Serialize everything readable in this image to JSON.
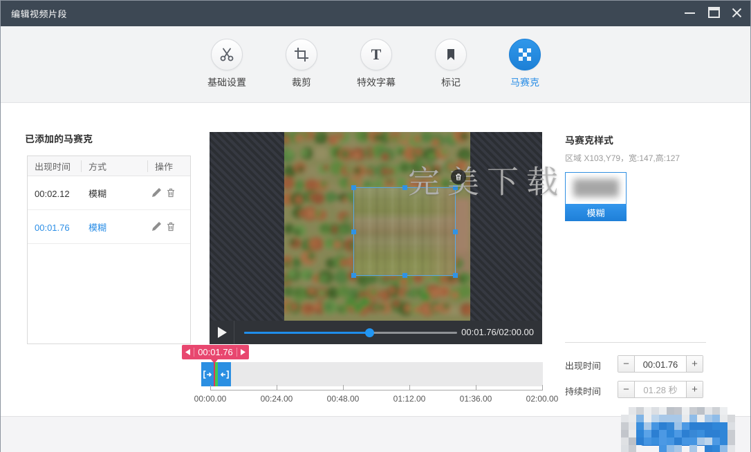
{
  "window": {
    "title": "编辑视频片段"
  },
  "toolbar": {
    "items": [
      {
        "label": "基础设置",
        "icon": "scissors"
      },
      {
        "label": "裁剪",
        "icon": "crop"
      },
      {
        "label": "特效字幕",
        "icon": "text"
      },
      {
        "label": "标记",
        "icon": "bookmark"
      },
      {
        "label": "马赛克",
        "icon": "mosaic",
        "active": true
      }
    ]
  },
  "mosaic_list": {
    "title": "已添加的马赛克",
    "columns": [
      "出现时间",
      "方式",
      "操作"
    ],
    "rows": [
      {
        "time": "00:02.12",
        "mode": "模糊",
        "selected": false
      },
      {
        "time": "00:01.76",
        "mode": "模糊",
        "selected": true
      }
    ]
  },
  "preview": {
    "watermark": "完美下载"
  },
  "player": {
    "time_display": "00:01.76/02:00.00",
    "progress_percent": 59
  },
  "timeline": {
    "marker_time": "00:01.76",
    "ruler_labels": [
      "00:00.00",
      "00:24.00",
      "00:48.00",
      "01:12.00",
      "01:36.00",
      "02:00.00"
    ]
  },
  "mosaic_style": {
    "title": "马赛克样式",
    "region_info": "区域 X103,Y79，宽:147,高:127",
    "style_label": "模糊"
  },
  "settings": {
    "appear_time": {
      "label": "出现时间",
      "value": "00:01.76"
    },
    "duration": {
      "label": "持续时间",
      "value": "01.28 秒"
    }
  },
  "colors": {
    "accent_blue": "#2b8ee6",
    "marker_pink": "#e8476f",
    "playhead_green": "#42cb50",
    "titlebar": "#3d4854"
  }
}
